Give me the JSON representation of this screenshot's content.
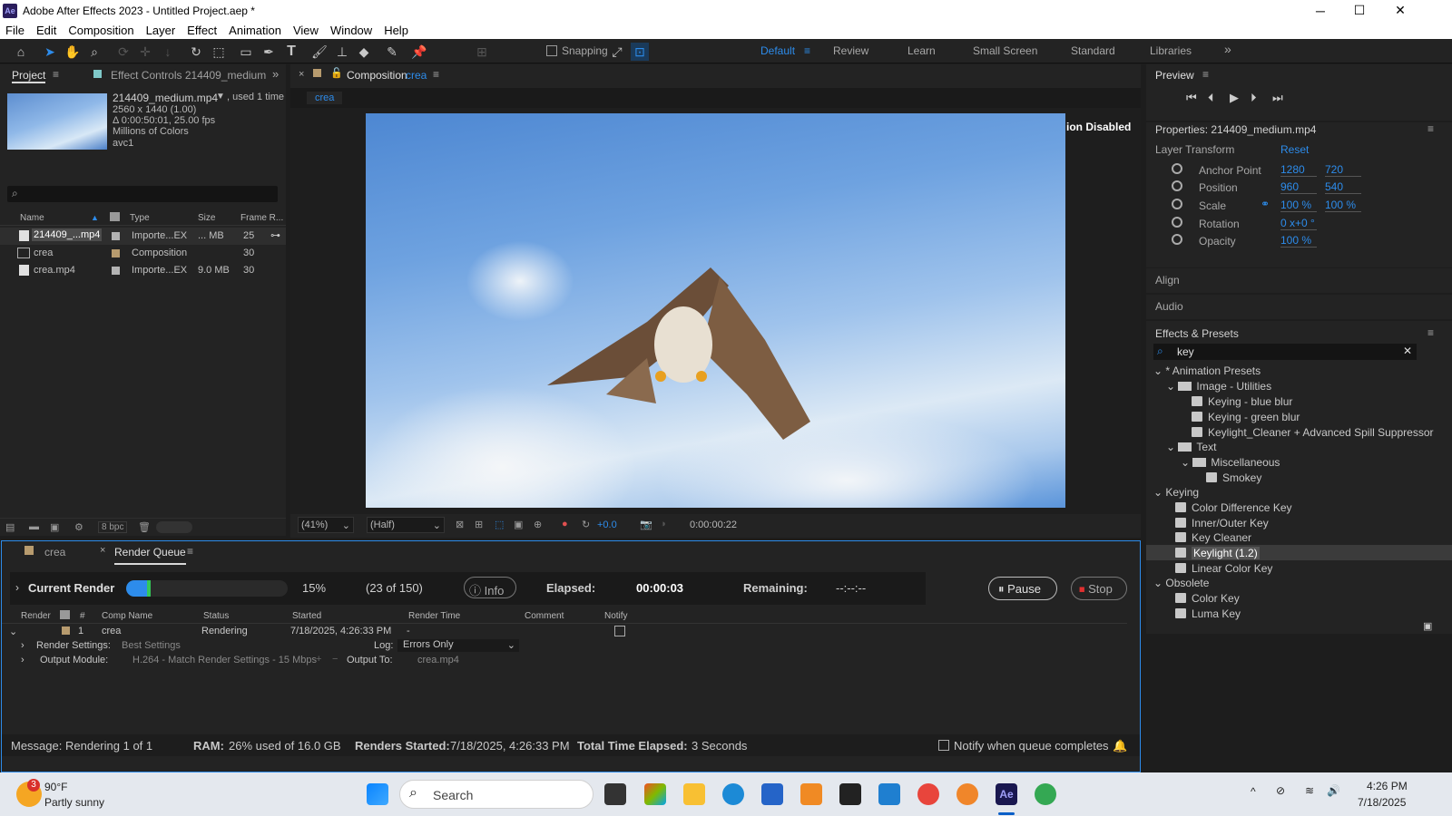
{
  "window": {
    "title": "Adobe After Effects 2023 - Untitled Project.aep *",
    "logo": "Ae",
    "minimize": "─",
    "maximize": "☐",
    "close": "✕"
  },
  "menu": [
    "File",
    "Edit",
    "Composition",
    "Layer",
    "Effect",
    "Animation",
    "View",
    "Window",
    "Help"
  ],
  "toolbar": {
    "snapping": "Snapping",
    "workspaces": [
      "Default",
      "Review",
      "Learn",
      "Small Screen",
      "Standard",
      "Libraries"
    ],
    "more": "»"
  },
  "project": {
    "tab_project": "Project",
    "tab_effect_controls": "Effect Controls 214409_medium",
    "item_name": "214409_medium.mp4",
    "used": ", used 1 time",
    "dims": "2560 x 1440 (1.00)",
    "duration": "Δ 0:00:50:01, 25.00 fps",
    "colors": "Millions of Colors",
    "codec": "avc1",
    "columns": [
      "Name",
      "Type",
      "Size",
      "Frame R..."
    ],
    "items": [
      {
        "name": "214409_...mp4",
        "type": "Importe...EX",
        "size": "... MB",
        "fps": "25"
      },
      {
        "name": "crea",
        "type": "Composition",
        "size": "",
        "fps": "30"
      },
      {
        "name": "crea.mp4",
        "type": "Importe...EX",
        "size": "9.0 MB",
        "fps": "30"
      }
    ],
    "bpc": "8 bpc"
  },
  "composition": {
    "tab": "Composition",
    "comp_name": "crea",
    "sub_tab": "crea",
    "overlay": "ion Disabled",
    "zoom": "(41%)",
    "resolution": "(Half)",
    "exposure": "+0.0",
    "timecode": "0:00:00:22"
  },
  "preview": {
    "title": "Preview"
  },
  "properties": {
    "title": "Properties: 214409_medium.mp4",
    "section": "Layer Transform",
    "reset": "Reset",
    "rows": [
      {
        "label": "Anchor Point",
        "v1": "1280",
        "v2": "720"
      },
      {
        "label": "Position",
        "v1": "960",
        "v2": "540"
      },
      {
        "label": "Scale",
        "v1": "100 %",
        "v2": "100 %"
      },
      {
        "label": "Rotation",
        "v1": "0 x+0 °",
        "v2": ""
      },
      {
        "label": "Opacity",
        "v1": "100 %",
        "v2": ""
      }
    ]
  },
  "align": "Align",
  "audio": "Audio",
  "effects": {
    "title": "Effects & Presets",
    "search": "key",
    "items": [
      "* Animation Presets",
      "Image - Utilities",
      "Keying - blue blur",
      "Keying - green blur",
      "Keylight_Cleaner + Advanced Spill Suppressor",
      "Text",
      "Miscellaneous",
      "Smokey",
      "Keying",
      "Color Difference Key",
      "Inner/Outer Key",
      "Key Cleaner",
      "Keylight (1.2)",
      "Linear Color Key",
      "Obsolete",
      "Color Key",
      "Luma Key"
    ]
  },
  "render": {
    "tab_crea": "crea",
    "tab_rq": "Render Queue",
    "current": "Current Render",
    "progress": 0.15,
    "percent": "15%",
    "count": "(23 of 150)",
    "info": "Info",
    "elapsed_lbl": "Elapsed:",
    "elapsed": "00:00:03",
    "remaining_lbl": "Remaining:",
    "remaining": "--:--:--",
    "pause": "Pause",
    "stop": "Stop",
    "columns": [
      "Render",
      "#",
      "Comp Name",
      "Status",
      "Started",
      "Render Time",
      "Comment",
      "Notify"
    ],
    "item": {
      "num": "1",
      "comp": "crea",
      "status": "Rendering",
      "started": "7/18/2025, 4:26:33 PM",
      "time": "-"
    },
    "rs_lbl": "Render Settings:",
    "rs": "Best Settings",
    "log_lbl": "Log:",
    "log": "Errors Only",
    "om_lbl": "Output Module:",
    "om": "H.264 - Match Render Settings - 15 Mbps",
    "out_lbl": "Output To:",
    "out": "crea.mp4"
  },
  "status": {
    "msg_lbl": "Message:",
    "msg": "Rendering 1 of 1",
    "ram_lbl": "RAM:",
    "ram": "26% used of 16.0 GB",
    "rs_lbl": "Renders Started:",
    "rs": "7/18/2025, 4:26:33 PM",
    "tte_lbl": "Total Time Elapsed:",
    "tte": "3 Seconds",
    "notify": "Notify when queue completes"
  },
  "taskbar": {
    "temp": "90°F",
    "weather": "Partly sunny",
    "badge": "3",
    "search": "Search",
    "time": "4:26 PM",
    "date": "7/18/2025"
  }
}
